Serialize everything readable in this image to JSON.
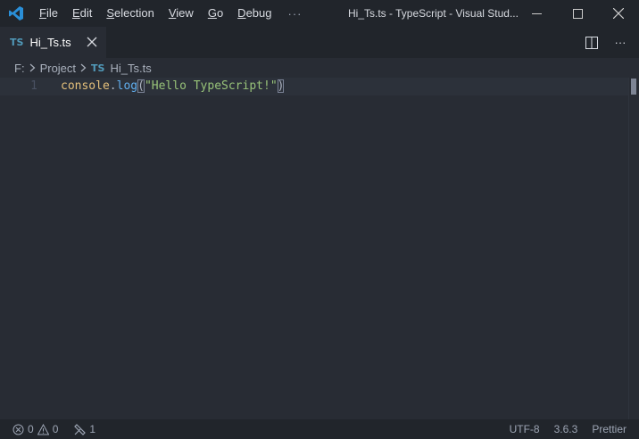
{
  "titlebar": {
    "menu": [
      {
        "first": "F",
        "rest": "ile"
      },
      {
        "first": "E",
        "rest": "dit"
      },
      {
        "first": "S",
        "rest": "election"
      },
      {
        "first": "V",
        "rest": "iew"
      },
      {
        "first": "G",
        "rest": "o"
      },
      {
        "first": "D",
        "rest": "ebug"
      }
    ],
    "more_label": "···",
    "window_title": "Hi_Ts.ts - TypeScript - Visual Stud...",
    "controls": [
      "minimize-icon",
      "maximize-icon",
      "close-icon"
    ]
  },
  "tab": {
    "lang_badge": "TS",
    "label": "Hi_Ts.ts",
    "badge_color": "#519aba"
  },
  "tab_actions": {
    "more_label": "···"
  },
  "breadcrumb": {
    "drive": "F:",
    "folder": "Project",
    "lang_badge": "TS",
    "file": "Hi_Ts.ts"
  },
  "editor": {
    "line_number": "1",
    "tokens": {
      "object": "console",
      "dot": ".",
      "method": "log",
      "open_paren": "(",
      "string": "\"Hello TypeScript!\"",
      "close_paren": ")"
    }
  },
  "statusbar": {
    "errors": "0",
    "warnings": "0",
    "tools": "1",
    "encoding": "UTF-8",
    "version": "3.6.3",
    "formatter": "Prettier"
  }
}
